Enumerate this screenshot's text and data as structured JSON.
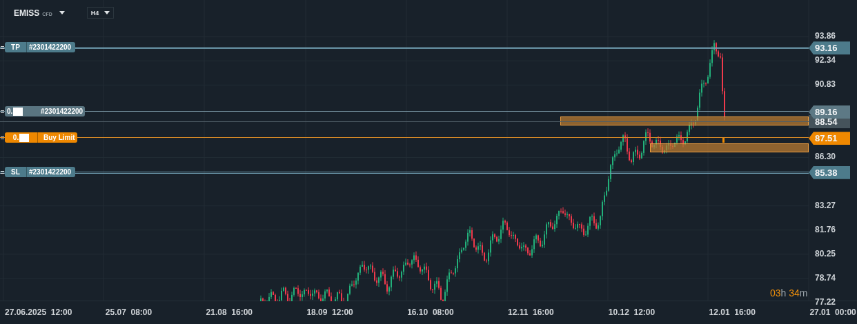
{
  "symbol": {
    "name": "EMISS",
    "type": "CFD"
  },
  "timeframe": "H4",
  "price_axis": {
    "ticks": [
      "93.86",
      "92.34",
      "90.83",
      "86.30",
      "83.27",
      "81.76",
      "80.25",
      "78.74",
      "77.22"
    ]
  },
  "time_axis": {
    "labels": [
      {
        "date": "27.06.2025",
        "time": "12:00"
      },
      {
        "date": "25.07",
        "time": "08:00"
      },
      {
        "date": "21.08",
        "time": "16:00"
      },
      {
        "date": "18.09",
        "time": "12:00"
      },
      {
        "date": "16.10",
        "time": "08:00"
      },
      {
        "date": "12.11",
        "time": "16:00"
      },
      {
        "date": "10.12",
        "time": "12:00"
      },
      {
        "date": "12.01",
        "time": "16:00"
      },
      {
        "date": "27.01",
        "time": "00:00"
      }
    ]
  },
  "order_lines": [
    {
      "kind": "tp",
      "label": "TP",
      "ticket": "#2301422200",
      "price": "93.16"
    },
    {
      "kind": "position",
      "volume": "0.",
      "ticket": "#2301422200",
      "price": "89.16"
    },
    {
      "kind": "pending",
      "volume": "0.",
      "order_type": "Buy Limit",
      "price": "87.51"
    },
    {
      "kind": "sl",
      "label": "SL",
      "ticket": "#2301422200",
      "price": "85.38"
    }
  ],
  "current_price": "88.54",
  "countdown": {
    "hours": "03",
    "hours_unit": "h",
    "minutes": "34",
    "minutes_unit": "m"
  }
}
